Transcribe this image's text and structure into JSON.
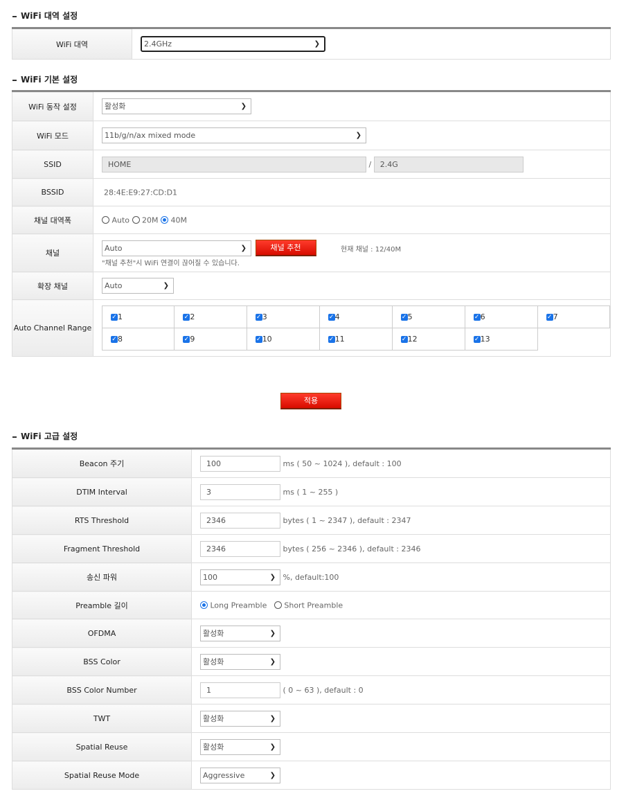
{
  "band": {
    "title": "WiFi 대역 설정",
    "label": "WiFi 대역",
    "value": "2.4GHz"
  },
  "basic": {
    "title": "WiFi 기본 설정",
    "mode_enable_label": "WiFi 동작 설정",
    "mode_enable_value": "활성화",
    "wifi_mode_label": "WiFi 모드",
    "wifi_mode_value": "11b/g/n/ax mixed mode",
    "ssid_label": "SSID",
    "ssid_value": "HOME",
    "ssid_sep": "/",
    "ssid_suffix": "2.4G",
    "bssid_label": "BSSID",
    "bssid_value": "28:4E:E9:27:CD:D1",
    "bandwidth_label": "채널 대역폭",
    "bandwidth_options": [
      "Auto",
      "20M",
      "40M"
    ],
    "bandwidth_selected": "40M",
    "channel_label": "채널",
    "channel_value": "Auto",
    "channel_recommend_button": "채널 추천",
    "current_channel": "현재 채널 : 12/40M",
    "channel_notice": "\"채널 추천\"시 WiFi 연결이 끊어질 수 있습니다.",
    "ext_channel_label": "확장 채널",
    "ext_channel_value": "Auto",
    "auto_range_label": "Auto Channel Range",
    "channels_row1": [
      "1",
      "2",
      "3",
      "4",
      "5",
      "6",
      "7"
    ],
    "channels_row2": [
      "8",
      "9",
      "10",
      "11",
      "12",
      "13"
    ]
  },
  "apply_button": "적용",
  "advanced": {
    "title": "WiFi 고급 설정",
    "beacon_label": "Beacon 주기",
    "beacon_value": "100",
    "beacon_note": "ms ( 50 ~ 1024 ), default : 100",
    "dtim_label": "DTIM Interval",
    "dtim_value": "3",
    "dtim_note": "ms ( 1 ~ 255 )",
    "rts_label": "RTS Threshold",
    "rts_value": "2346",
    "rts_note": "bytes ( 1 ~ 2347 ), default : 2347",
    "frag_label": "Fragment Threshold",
    "frag_value": "2346",
    "frag_note": "bytes ( 256 ~ 2346 ), default : 2346",
    "power_label": "송신 파워",
    "power_value": "100",
    "power_note": "%, default:100",
    "preamble_label": "Preamble 길이",
    "preamble_long": "Long Preamble",
    "preamble_short": "Short Preamble",
    "preamble_selected": "Long Preamble",
    "ofdma_label": "OFDMA",
    "ofdma_value": "활성화",
    "bss_color_label": "BSS Color",
    "bss_color_value": "활성화",
    "bss_color_num_label": "BSS Color Number",
    "bss_color_num_value": "1",
    "bss_color_num_note": "( 0 ~ 63 ), default : 0",
    "twt_label": "TWT",
    "twt_value": "활성화",
    "sr_label": "Spatial Reuse",
    "sr_value": "활성화",
    "sr_mode_label": "Spatial Reuse Mode",
    "sr_mode_value": "Aggressive"
  },
  "colors": {
    "accent_red": "#e8160a",
    "checkbox_blue": "#1a73e8"
  }
}
